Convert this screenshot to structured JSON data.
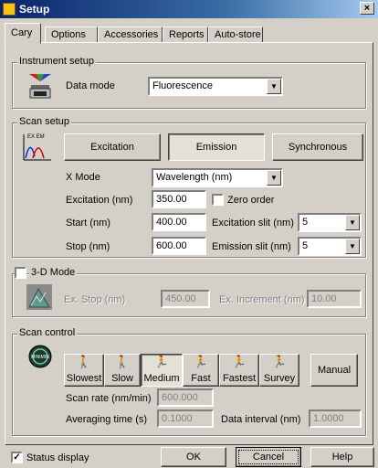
{
  "window": {
    "title": "Setup",
    "close_glyph": "×"
  },
  "tabs": [
    "Cary",
    "Options",
    "Accessories",
    "Reports",
    "Auto-store"
  ],
  "instrument_setup": {
    "legend": "Instrument setup",
    "data_mode_label": "Data mode",
    "data_mode_value": "Fluorescence"
  },
  "scan_setup": {
    "legend": "Scan setup",
    "buttons": {
      "excitation": "Excitation",
      "emission": "Emission",
      "synchronous": "Synchronous"
    },
    "icon_caption": "EX EM",
    "x_mode_label": "X Mode",
    "x_mode_value": "Wavelength (nm)",
    "excitation_label": "Excitation (nm)",
    "excitation_value": "350.00",
    "zero_order_label": "Zero order",
    "start_label": "Start (nm)",
    "start_value": "400.00",
    "excitation_slit_label": "Excitation slit (nm)",
    "excitation_slit_value": "5",
    "stop_label": "Stop (nm)",
    "stop_value": "600.00",
    "emission_slit_label": "Emission slit (nm)",
    "emission_slit_value": "5"
  },
  "three_d_mode": {
    "legend": "3-D Mode",
    "ex_stop_label": "Ex. Stop (nm)",
    "ex_stop_value": "450.00",
    "ex_increment_label": "Ex. Increment (nm)",
    "ex_increment_value": "10.00"
  },
  "scan_control": {
    "legend": "Scan control",
    "icon_caption": "MINIMIN",
    "speeds": [
      "Slowest",
      "Slow",
      "Medium",
      "Fast",
      "Fastest",
      "Survey"
    ],
    "selected_speed": "Medium",
    "manual_label": "Manual",
    "scan_rate_label": "Scan rate (nm/min)",
    "scan_rate_value": "600.000",
    "averaging_time_label": "Averaging time (s)",
    "averaging_time_value": "0.1000",
    "data_interval_label": "Data interval (nm)",
    "data_interval_value": "1.0000"
  },
  "footer": {
    "status_display_label": "Status display",
    "ok_label": "OK",
    "cancel_label": "Cancel",
    "help_label": "Help"
  }
}
